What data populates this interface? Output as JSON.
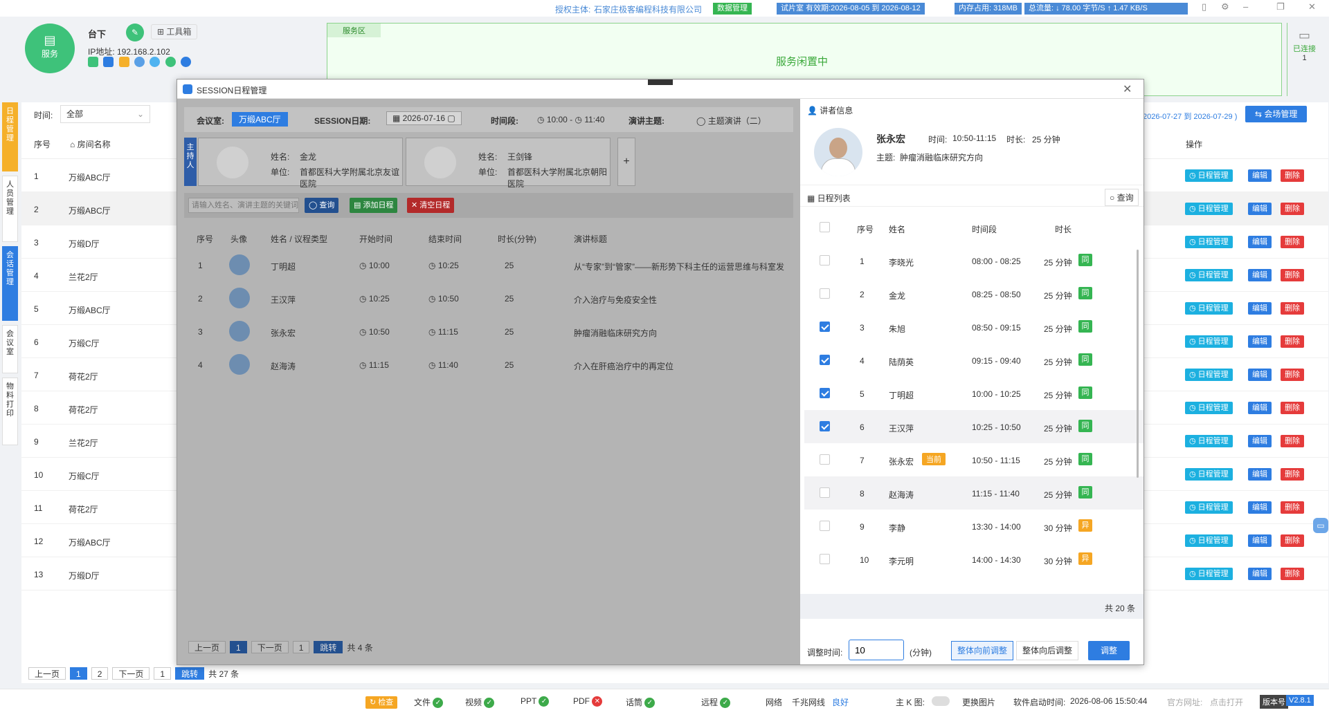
{
  "top": {
    "auth_label": "授权主体:",
    "auth_company": "石家庄极客编程科技有限公司",
    "data_mgmt": "数据管理",
    "trial": "试片室 有效期:2026-08-05 到 2026-08-12",
    "memory": "内存占用: 318MB",
    "traffic": "总流量: ↓ 78.00 字节/S ↑ 1.47 KB/S"
  },
  "header": {
    "service_label": "服务",
    "mode": "台下",
    "toolbox": "工具箱",
    "ip": "IP地址: 192.168.2.102"
  },
  "service_area": {
    "tag": "服务区",
    "status": "服务闲置中",
    "connected_label": "已连接",
    "connected_count": "1"
  },
  "nav": {
    "items": [
      "日程管理",
      "人员管理",
      "会话管理",
      "会议室",
      "物料打印"
    ]
  },
  "filter": {
    "time_label": "时间:",
    "time_value": "全部",
    "date_range": "2026-07-27 到 2026-07-29 )",
    "venue_btn": "会场管理"
  },
  "table": {
    "headers": [
      "序号",
      "房间名称",
      "操作"
    ],
    "rows": [
      [
        "1",
        "万缎ABC厅"
      ],
      [
        "2",
        "万缎ABC厅"
      ],
      [
        "3",
        "万缎D厅"
      ],
      [
        "4",
        "兰花2厅"
      ],
      [
        "5",
        "万缎ABC厅"
      ],
      [
        "6",
        "万缎C厅"
      ],
      [
        "7",
        "荷花2厅"
      ],
      [
        "8",
        "荷花2厅"
      ],
      [
        "9",
        "兰花2厅"
      ],
      [
        "10",
        "万缎C厅"
      ],
      [
        "11",
        "荷花2厅"
      ],
      [
        "12",
        "万缎ABC厅"
      ],
      [
        "13",
        "万缎D厅"
      ]
    ],
    "actions": [
      "日程管理",
      "编辑",
      "删除"
    ]
  },
  "pager": {
    "prev": "上一页",
    "p1": "1",
    "p2": "2",
    "next": "下一页",
    "input": "1",
    "jump": "跳转",
    "total": "共 27 条"
  },
  "dialog": {
    "title": "SESSION日程管理",
    "session": {
      "room_label": "会议室:",
      "room": "万缎ABC厅",
      "date_label": "SESSION日期:",
      "date": "2026-07-16",
      "period_label": "时间段:",
      "start": "10:00",
      "end": "11:40",
      "topic_label": "演讲主题:",
      "topic": "主题演讲（二）"
    },
    "hosts": {
      "label": "主持人",
      "list": [
        {
          "name_label": "姓名:",
          "name": "金龙",
          "unit_label": "单位:",
          "unit": "首都医科大学附属北京友谊医院"
        },
        {
          "name_label": "姓名:",
          "name": "王剑锋",
          "unit_label": "单位:",
          "unit": "首都医科大学附属北京朝阳医院"
        }
      ],
      "add": "+"
    },
    "search": {
      "placeholder": "请输入姓名、演讲主题的关键词",
      "query": "查询",
      "add": "添加日程",
      "clear": "清空日程"
    },
    "list": {
      "headers": [
        "序号",
        "头像",
        "姓名 / 议程类型",
        "开始时间",
        "结束时间",
        "时长(分钟)",
        "演讲标题"
      ],
      "rows": [
        {
          "no": "1",
          "name": "丁明超",
          "start": "10:00",
          "end": "10:25",
          "dur": "25",
          "title": "从“专家”到“管家”——新形势下科主任的运营思维与科室发"
        },
        {
          "no": "2",
          "name": "王汉萍",
          "start": "10:25",
          "end": "10:50",
          "dur": "25",
          "title": "介入治疗与免疫安全性"
        },
        {
          "no": "3",
          "name": "张永宏",
          "start": "10:50",
          "end": "11:15",
          "dur": "25",
          "title": "肿瘤消融临床研究方向"
        },
        {
          "no": "4",
          "name": "赵海涛",
          "start": "11:15",
          "end": "11:40",
          "dur": "25",
          "title": "介入在肝癌治疗中的再定位"
        }
      ]
    },
    "pager": {
      "prev": "上一页",
      "p1": "1",
      "next": "下一页",
      "input": "1",
      "jump": "跳转",
      "total": "共 4 条"
    },
    "speaker": {
      "section": "讲者信息",
      "name": "张永宏",
      "time_label": "时间:",
      "time": "10:50-11:15",
      "dur_label": "时长:",
      "dur": "25 分钟",
      "topic_label": "主题:",
      "topic": "肿瘤消融临床研究方向"
    },
    "schedule": {
      "section": "日程列表",
      "query": "查询",
      "headers": [
        "序号",
        "姓名",
        "时间段",
        "时长"
      ],
      "rows": [
        {
          "no": "1",
          "name": "李晓光",
          "time": "08:00 - 08:25",
          "dur": "25 分钟",
          "tag": "同",
          "checked": false
        },
        {
          "no": "2",
          "name": "金龙",
          "time": "08:25 - 08:50",
          "dur": "25 分钟",
          "tag": "同",
          "checked": false
        },
        {
          "no": "3",
          "name": "朱旭",
          "time": "08:50 - 09:15",
          "dur": "25 分钟",
          "tag": "同",
          "checked": true
        },
        {
          "no": "4",
          "name": "陆荫英",
          "time": "09:15 - 09:40",
          "dur": "25 分钟",
          "tag": "同",
          "checked": true
        },
        {
          "no": "5",
          "name": "丁明超",
          "time": "10:00 - 10:25",
          "dur": "25 分钟",
          "tag": "同",
          "checked": true
        },
        {
          "no": "6",
          "name": "王汉萍",
          "time": "10:25 - 10:50",
          "dur": "25 分钟",
          "tag": "同",
          "checked": true
        },
        {
          "no": "7",
          "name": "张永宏",
          "badge": "当前",
          "time": "10:50 - 11:15",
          "dur": "25 分钟",
          "tag": "同",
          "checked": false
        },
        {
          "no": "8",
          "name": "赵海涛",
          "time": "11:15 - 11:40",
          "dur": "25 分钟",
          "tag": "同",
          "checked": false
        },
        {
          "no": "9",
          "name": "李静",
          "time": "13:30 - 14:00",
          "dur": "30 分钟",
          "tag": "异",
          "checked": false
        },
        {
          "no": "10",
          "name": "李元明",
          "time": "14:00 - 14:30",
          "dur": "30 分钟",
          "tag": "异",
          "checked": false
        }
      ],
      "total": "共 20 条"
    },
    "adjust": {
      "label": "调整时间:",
      "value": "10",
      "unit": "(分钟)",
      "forward": "整体向前调整",
      "backward": "整体向后调整",
      "apply": "调整"
    }
  },
  "bottom": {
    "check": "检查",
    "file": "文件",
    "video": "视频",
    "ppt": "PPT",
    "pdf": "PDF",
    "mic": "话筒",
    "remote": "远程",
    "net_label": "网络",
    "net_type": "千兆网线",
    "net_status": "良好",
    "k_label": "主 K 图:",
    "replace": "更换图片",
    "start_label": "软件启动时间:",
    "start_time": "2026-08-06 15:50:44",
    "site_label": "官方网址:",
    "site": "点击打开",
    "ver_label": "版本号",
    "ver": "V2.8.1"
  }
}
